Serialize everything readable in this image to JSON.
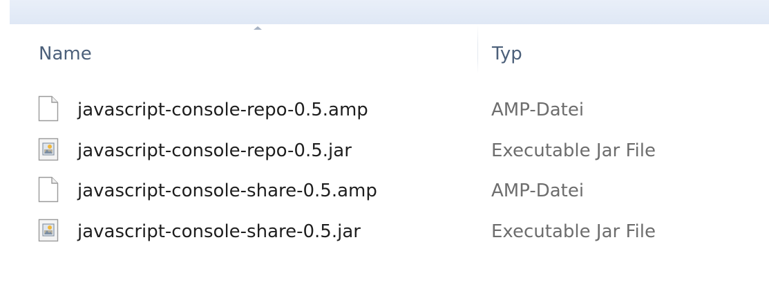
{
  "columns": {
    "name_label": "Name",
    "type_label": "Typ",
    "sort_column": "Name",
    "sort_direction": "ascending"
  },
  "files": [
    {
      "name": "javascript-console-repo-0.5.amp",
      "type": "AMP-Datei",
      "icon": "blank-document-icon"
    },
    {
      "name": "javascript-console-repo-0.5.jar",
      "type": "Executable Jar File",
      "icon": "jar-file-icon"
    },
    {
      "name": "javascript-console-share-0.5.amp",
      "type": "AMP-Datei",
      "icon": "blank-document-icon"
    },
    {
      "name": "javascript-console-share-0.5.jar",
      "type": "Executable Jar File",
      "icon": "jar-file-icon"
    }
  ],
  "colors": {
    "header_text": "#4c607a",
    "name_text": "#1e1e1e",
    "type_text": "#6d6d6d",
    "toolbar_band": "#e3eaf6"
  }
}
